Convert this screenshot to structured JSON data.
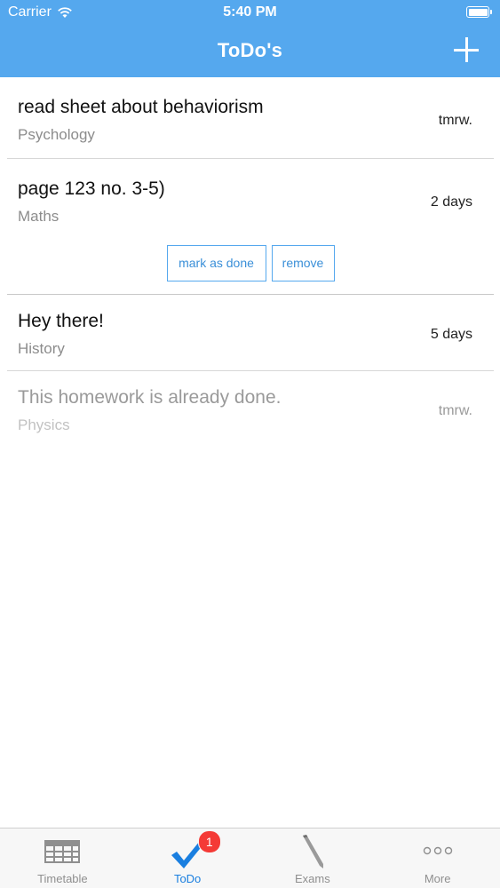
{
  "status_bar": {
    "carrier": "Carrier",
    "time": "5:40 PM"
  },
  "nav": {
    "title": "ToDo's",
    "add_icon": "plus-icon"
  },
  "todos": [
    {
      "title": "read sheet about behaviorism",
      "subject": "Psychology",
      "due": "tmrw.",
      "done": false
    },
    {
      "title": "page 123 no. 3-5)",
      "subject": "Maths",
      "due": "2 days",
      "done": false,
      "actions": {
        "mark_done": "mark as done",
        "remove": "remove"
      }
    },
    {
      "title": "Hey there!",
      "subject": "History",
      "due": "5 days",
      "done": false
    },
    {
      "title": "This homework is already done.",
      "subject": "Physics",
      "due": "tmrw.",
      "done": true
    }
  ],
  "tab_bar": {
    "tabs": [
      {
        "label": "Timetable",
        "icon": "calendar-grid-icon"
      },
      {
        "label": "ToDo",
        "icon": "checkmark-icon",
        "badge": "1",
        "active": true
      },
      {
        "label": "Exams",
        "icon": "pen-icon"
      },
      {
        "label": "More",
        "icon": "ellipsis-icon"
      }
    ]
  },
  "colors": {
    "accent": "#55a8ee",
    "active_tab": "#1a7fe0",
    "badge": "#f43a36"
  }
}
